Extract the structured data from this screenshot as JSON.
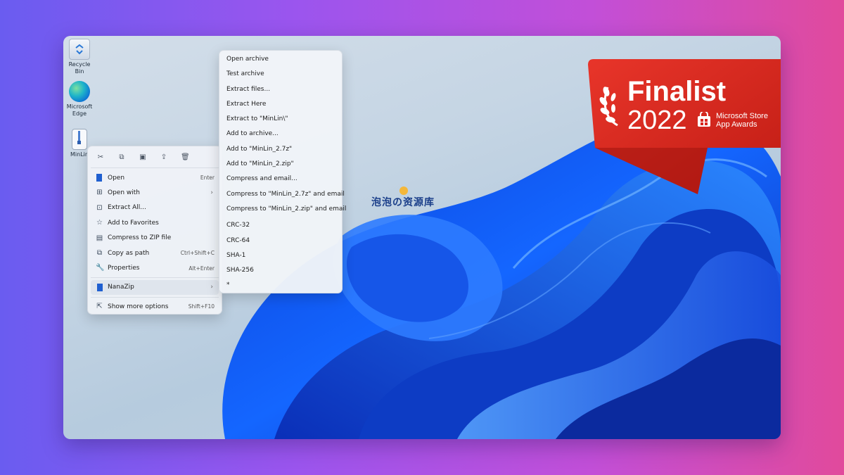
{
  "desktop": {
    "icons": [
      {
        "label": "Recycle Bin",
        "icon": "recycle-bin-icon"
      },
      {
        "label": "Microsoft Edge",
        "icon": "edge-icon"
      },
      {
        "label": "MinLin",
        "icon": "zip-file-icon"
      }
    ]
  },
  "context_menu": {
    "toolbar": [
      "cut-icon",
      "copy-icon",
      "rename-icon",
      "share-icon",
      "delete-icon"
    ],
    "items": [
      {
        "label": "Open",
        "shortcut": "Enter",
        "icon": "nanazip-icon"
      },
      {
        "label": "Open with",
        "shortcut": "",
        "icon": "open-with-icon",
        "submenu": true
      },
      {
        "label": "Extract All...",
        "shortcut": "",
        "icon": "extract-icon"
      },
      {
        "label": "Add to Favorites",
        "shortcut": "",
        "icon": "star-icon"
      },
      {
        "label": "Compress to ZIP file",
        "shortcut": "",
        "icon": "zip-icon"
      },
      {
        "label": "Copy as path",
        "shortcut": "Ctrl+Shift+C",
        "icon": "copy-path-icon"
      },
      {
        "label": "Properties",
        "shortcut": "Alt+Enter",
        "icon": "wrench-icon"
      },
      {
        "label": "NanaZip",
        "shortcut": "",
        "icon": "nanazip-icon",
        "submenu": true,
        "highlighted": true
      },
      {
        "label": "Show more options",
        "shortcut": "Shift+F10",
        "icon": "more-options-icon"
      }
    ]
  },
  "nanazip_submenu": {
    "items": [
      "Open archive",
      "Test archive",
      "Extract files...",
      "Extract Here",
      "Extract to \"MinLin\\\"",
      "Add to archive...",
      "Add to \"MinLin_2.7z\"",
      "Add to \"MinLin_2.zip\"",
      "Compress and email...",
      "Compress to \"MinLin_2.7z\" and email",
      "Compress to \"MinLin_2.zip\" and email",
      "CRC-32",
      "CRC-64",
      "SHA-1",
      "SHA-256",
      "*"
    ]
  },
  "watermark": {
    "text": "泡泡の资源库"
  },
  "badge": {
    "title": "Finalist",
    "year": "2022",
    "line1": "Microsoft Store",
    "line2": "App Awards",
    "color": "#d9251d"
  }
}
